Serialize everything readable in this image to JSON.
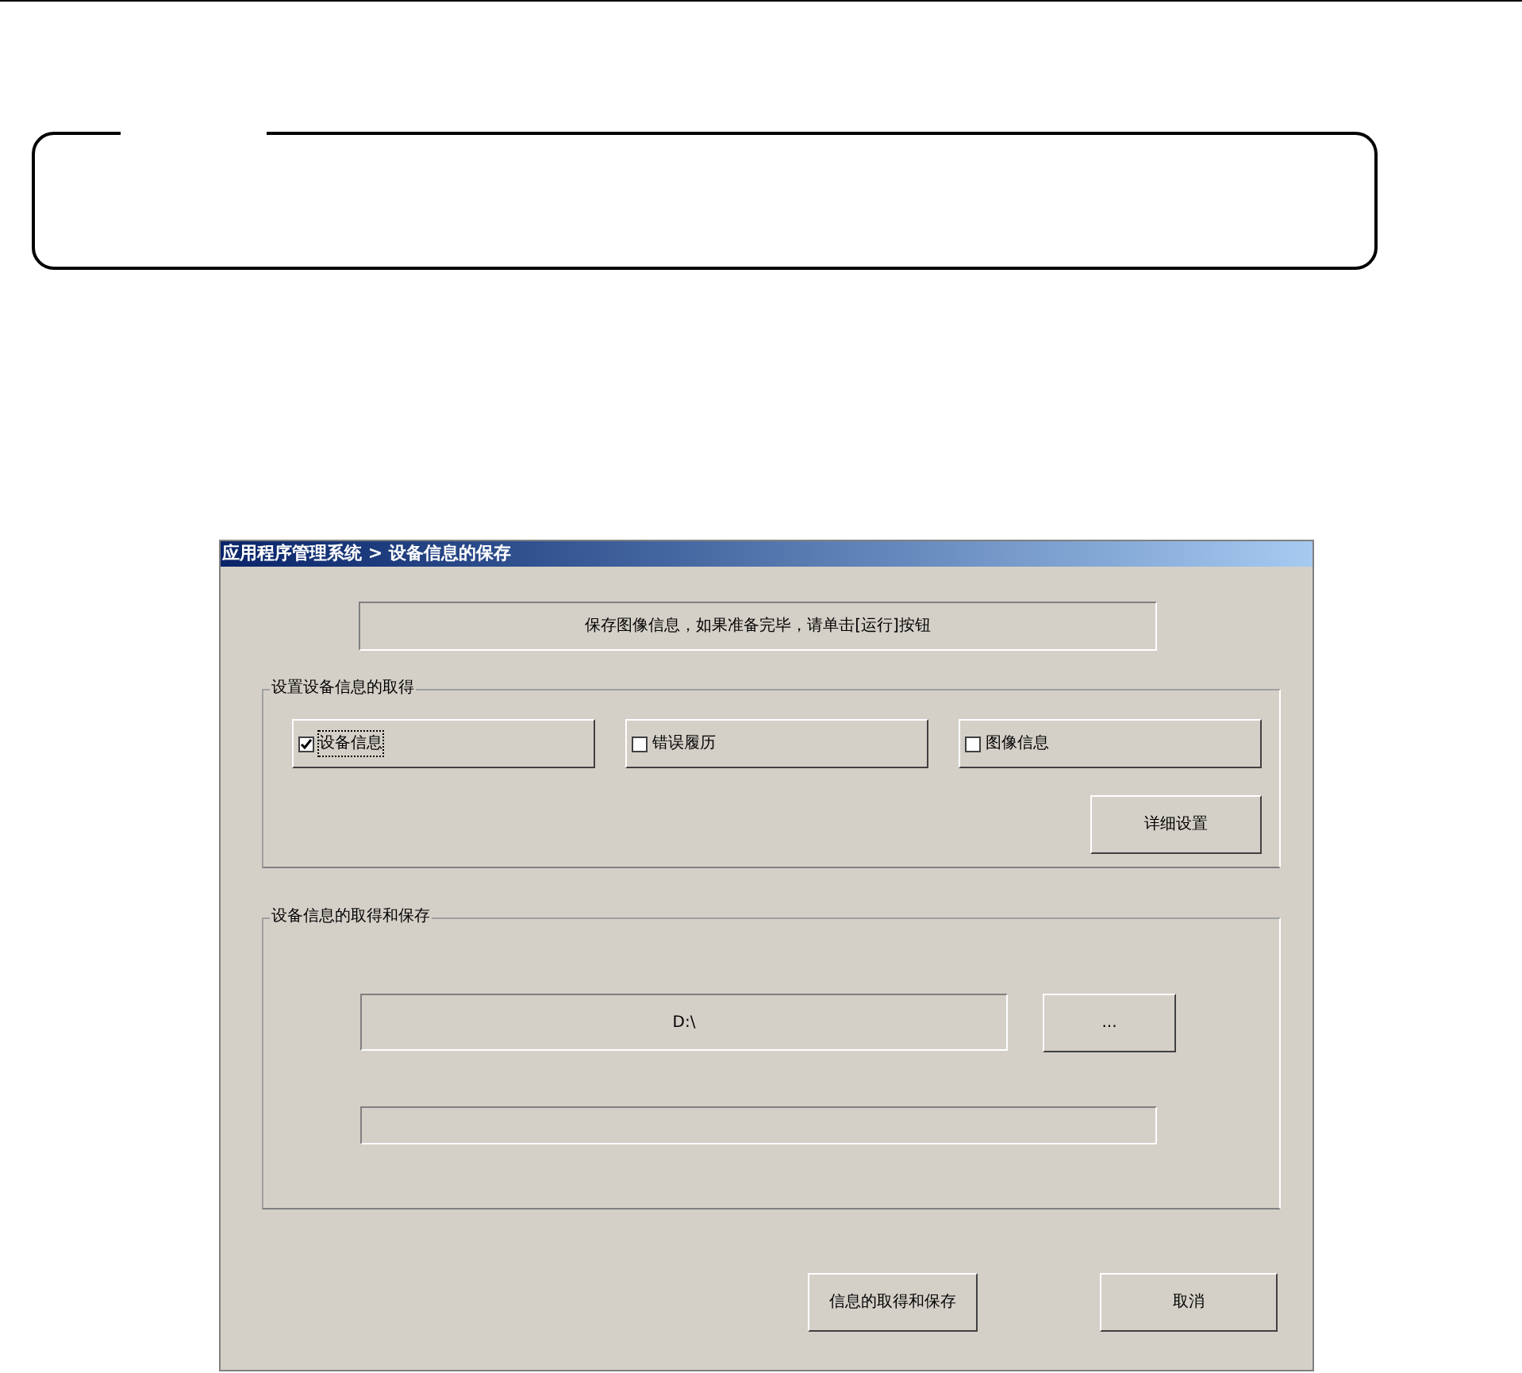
{
  "dialog": {
    "title": "应用程序管理系统 > 设备信息的保存",
    "message": "保存图像信息，如果准备完毕，请单击[运行]按钮",
    "acquisition_group": {
      "label": "设置设备信息的取得",
      "options": [
        {
          "label": "设备信息",
          "checked": true,
          "focused": true
        },
        {
          "label": "错误履历",
          "checked": false,
          "focused": false
        },
        {
          "label": "图像信息",
          "checked": false,
          "focused": false
        }
      ],
      "detail_button": "详细设置"
    },
    "save_group": {
      "label": "设备信息的取得和保存",
      "path": "D:\\",
      "browse_button": "..."
    },
    "buttons": [
      "信息的取得和保存",
      "取消"
    ]
  }
}
